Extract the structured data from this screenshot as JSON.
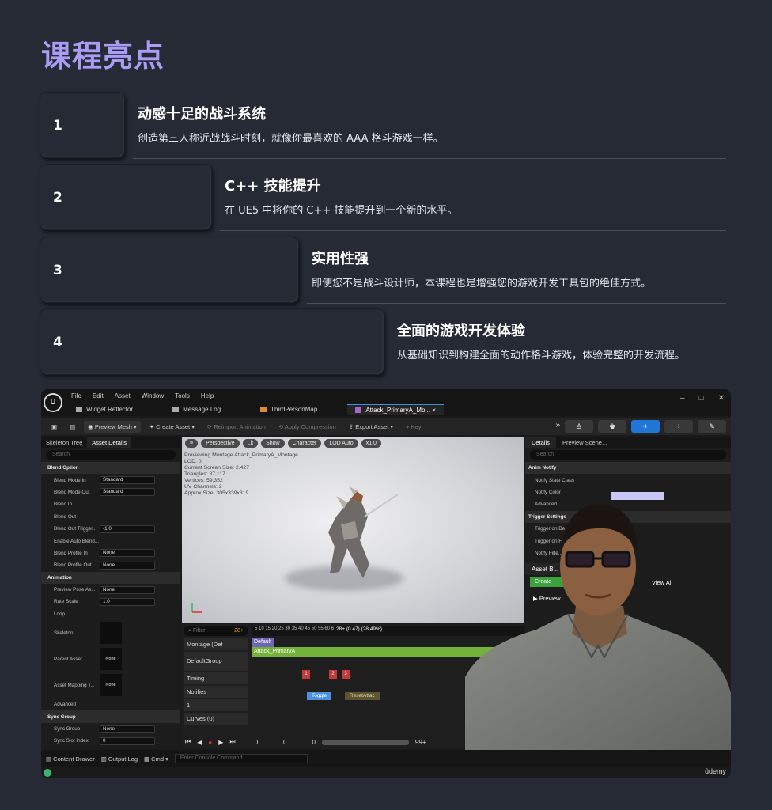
{
  "page": {
    "title": "课程亮点"
  },
  "highlights": [
    {
      "num": "1",
      "title": "动感十足的战斗系统",
      "desc": "创造第三人称近战战斗时刻，就像你最喜欢的 AAA 格斗游戏一样。"
    },
    {
      "num": "2",
      "title": "C++ 技能提升",
      "desc": "在 UE5 中将你的 C++ 技能提升到一个新的水平。"
    },
    {
      "num": "3",
      "title": "实用性强",
      "desc": "即使您不是战斗设计师，本课程也是增强您的游戏开发工具包的绝佳方式。"
    },
    {
      "num": "4",
      "title": "全面的游戏开发体验",
      "desc": "从基础知识到构建全面的动作格斗游戏，体验完整的开发流程。"
    }
  ],
  "editor": {
    "menu": [
      "File",
      "Edit",
      "Asset",
      "Window",
      "Tools",
      "Help"
    ],
    "tabs": [
      "Widget Reflector",
      "Message Log",
      "ThirdPersonMap",
      "Attack_PrimaryA_Mo..."
    ],
    "toolbar": {
      "preview_mesh": "Preview Mesh",
      "create_asset": "Create Asset",
      "reimport": "Reimport Animation",
      "apply_compression": "Apply Compression",
      "export_asset": "Export Asset",
      "key": "Key"
    },
    "left_tabs": [
      "Skeleton Tree",
      "Asset Details"
    ],
    "search_placeholder": "Search",
    "left_props": [
      {
        "label": "Blend Option",
        "cat": true
      },
      {
        "label": "Blend Mode In",
        "value": "Standard"
      },
      {
        "label": "Blend Mode Out",
        "value": "Standard"
      },
      {
        "label": "Blend In"
      },
      {
        "label": "Blend Out"
      },
      {
        "label": "Blend Out Trigger...",
        "value": "-1.0"
      },
      {
        "label": "Enable Auto Blend..."
      },
      {
        "label": "Blend Profile In",
        "value": "None"
      },
      {
        "label": "Blend Profile Out",
        "value": "None"
      },
      {
        "label": "Animation",
        "cat": true
      },
      {
        "label": "Preview Pose As...",
        "value": "None"
      },
      {
        "label": "Rate Scale",
        "value": "1.0"
      },
      {
        "label": "Loop"
      }
    ],
    "left_assets": [
      {
        "label": "Skeleton",
        "thumb": ""
      },
      {
        "label": "Parent Asset",
        "thumb": "None"
      },
      {
        "label": "Asset Mapping T...",
        "thumb": "None"
      }
    ],
    "left_tail": [
      {
        "label": "Advanced"
      },
      {
        "label": "Sync Group",
        "cat": true
      },
      {
        "label": "Sync Group",
        "value": "None"
      },
      {
        "label": "Sync Slot Index",
        "value": "0"
      }
    ],
    "viewport": {
      "pills": [
        "Perspective",
        "Lit",
        "Show",
        "Character",
        "LOD Auto",
        "x1.0"
      ],
      "info": [
        "Previewing Montage Attack_PrimaryA_Montage",
        "LOD: 0",
        "Current Screen Size: 2.427",
        "Triangles: 87,117",
        "Vertices: 59,352",
        "UV Channels: 2",
        "Approx Size: 305x339x319"
      ]
    },
    "timeline": {
      "filter": "Filter",
      "count": "28+",
      "rows": [
        "Montage (Def",
        "DefaultGroup",
        "Timing",
        "Notifies",
        "1",
        "Curves (0)"
      ],
      "default_label": "Default",
      "attack_label": "Attack_PrimaryA",
      "playhead_readout": "28+ (0.47) (28.49%)",
      "ruler": "5   10   15   20   25   30   35   40   45   50   55   60   65   70   75   80   85   90   95",
      "markers": [
        "1",
        "2",
        "3"
      ],
      "notify_a": "Toggle",
      "notify_b": "ResetAttac",
      "transport_vals": [
        "0",
        "0",
        "0",
        "99+"
      ]
    },
    "right_tabs": [
      "Details",
      "Preview Scene..."
    ],
    "right_props": [
      {
        "label": "Anim Notify",
        "cat": true
      },
      {
        "label": "Notify State Class"
      },
      {
        "label": "Notify Color"
      },
      {
        "label": "Advanced"
      },
      {
        "label": "Trigger Settings",
        "cat": true
      },
      {
        "label": "Trigger on De..."
      },
      {
        "label": "Trigger on F..."
      },
      {
        "label": "Notify Filte..."
      }
    ],
    "asset_browser": {
      "tab": "Asset B...",
      "create": "Create",
      "view_all": "View All",
      "preview": "Preview"
    },
    "statusbar": {
      "content_drawer": "Content Drawer",
      "output_log": "Output Log",
      "cmd": "Cmd",
      "console_placeholder": "Enter Console Command"
    },
    "watermark": "ûdemy"
  }
}
